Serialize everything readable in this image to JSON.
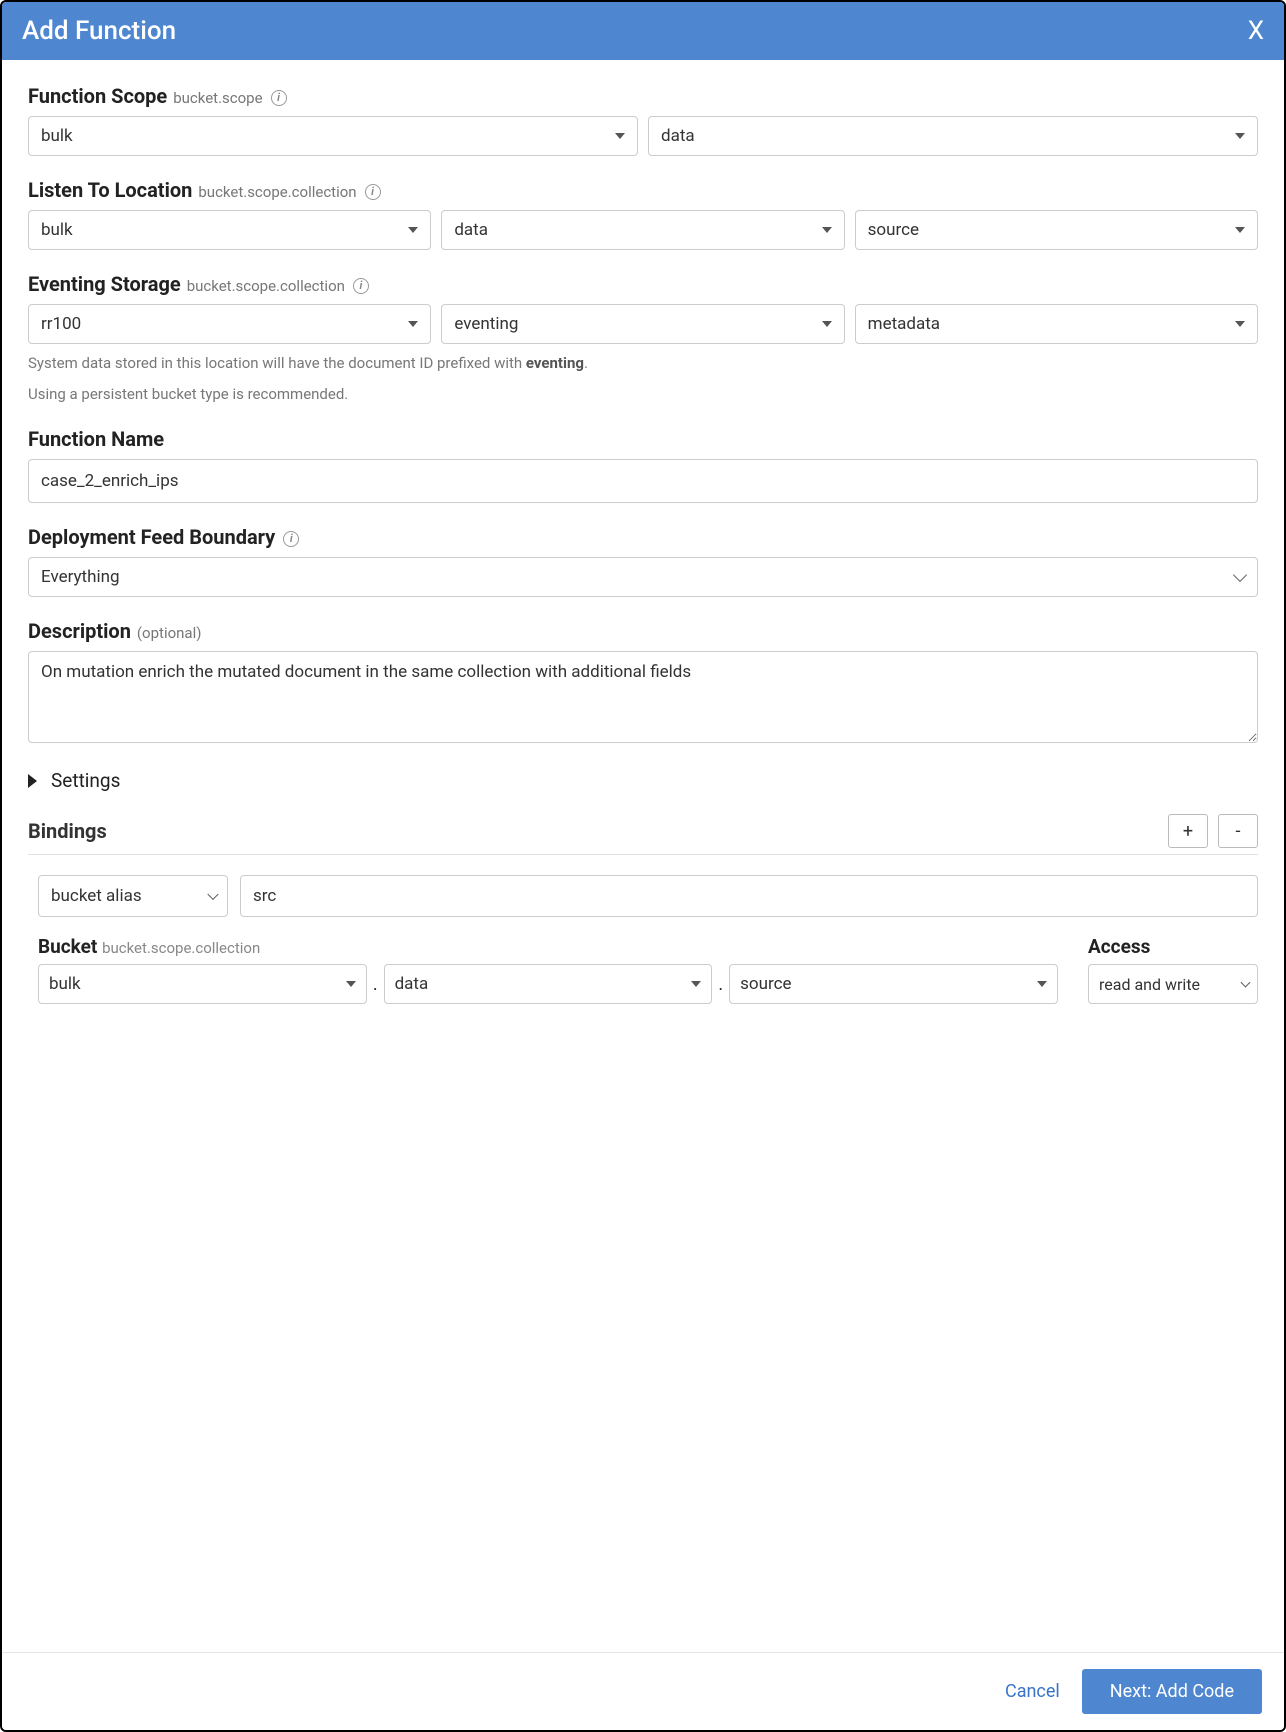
{
  "title": "Add Function",
  "close": "X",
  "functionScope": {
    "label": "Function Scope",
    "sub": "bucket.scope",
    "bucket": "bulk",
    "scope": "data"
  },
  "listenTo": {
    "label": "Listen To Location",
    "sub": "bucket.scope.collection",
    "bucket": "bulk",
    "scope": "data",
    "collection": "source"
  },
  "eventingStorage": {
    "label": "Eventing Storage",
    "sub": "bucket.scope.collection",
    "bucket": "rr100",
    "scope": "eventing",
    "collection": "metadata",
    "helper_prefix": "System data stored in this location will have the document ID prefixed with ",
    "helper_bold": "eventing",
    "helper_suffix": ".",
    "helper2": "Using a persistent bucket type is recommended."
  },
  "functionName": {
    "label": "Function Name",
    "value": "case_2_enrich_ips"
  },
  "feedBoundary": {
    "label": "Deployment Feed Boundary",
    "value": "Everything"
  },
  "description": {
    "label": "Description",
    "optional": "(optional)",
    "value": "On mutation enrich the mutated document in the same collection with additional fields"
  },
  "settings": {
    "label": "Settings"
  },
  "bindings": {
    "label": "Bindings",
    "plus": "+",
    "minus": "-",
    "type": "bucket alias",
    "alias": "src",
    "bucketLabel": "Bucket",
    "bucketSub": "bucket.scope.collection",
    "accessLabel": "Access",
    "bucket": "bulk",
    "scope": "data",
    "collection": "source",
    "access": "read and write"
  },
  "footer": {
    "cancel": "Cancel",
    "next": "Next: Add Code"
  }
}
